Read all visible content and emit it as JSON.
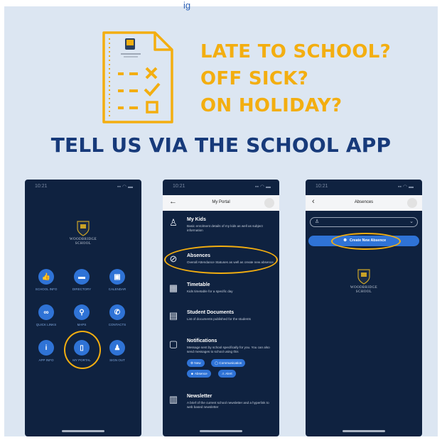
{
  "top_text": "ig",
  "headline": {
    "line1": "LATE TO SCHOOL?",
    "line2": "OFF SICK?",
    "line3": "ON HOLIDAY?"
  },
  "banner": "TELL US VIA THE SCHOOL APP",
  "colors": {
    "background": "#dce6f2",
    "accent": "#f3ae10",
    "navy": "#173a7a",
    "phone_bg": "#0f2240",
    "button_blue": "#2f73d6"
  },
  "phone1": {
    "time": "10:21",
    "school_name": "WOODBRIDGE SCHOOL",
    "buttons": [
      {
        "label": "SCHOOL INFO",
        "icon": "thumbs-up-icon",
        "glyph": "👍"
      },
      {
        "label": "DIRECTORY",
        "icon": "folder-icon",
        "glyph": "▬"
      },
      {
        "label": "CALENDAR",
        "icon": "calendar-icon",
        "glyph": "▣"
      },
      {
        "label": "QUICK LINKS",
        "icon": "link-icon",
        "glyph": "∞"
      },
      {
        "label": "MAPS",
        "icon": "map-pin-icon",
        "glyph": "⚲"
      },
      {
        "label": "CONTACTS",
        "icon": "phone-icon",
        "glyph": "✆"
      },
      {
        "label": "APP INFO",
        "icon": "info-icon",
        "glyph": "i"
      },
      {
        "label": "MY PORTAL",
        "icon": "portal-door-icon",
        "glyph": "▯"
      },
      {
        "label": "SIGN OUT",
        "icon": "users-icon",
        "glyph": "♟"
      }
    ]
  },
  "phone2": {
    "time": "10:21",
    "title": "My Portal",
    "items": [
      {
        "title": "My Kids",
        "desc": "Basic enrolment details of my kids as well as subject information",
        "icon": "student-icon",
        "glyph": "♙"
      },
      {
        "title": "Absences",
        "desc": "Overall Attendance Statuses as well as create new absence",
        "icon": "no-entry-icon",
        "glyph": "⊘"
      },
      {
        "title": "Timetable",
        "desc": "Kids timetable for a specific day",
        "icon": "timetable-icon",
        "glyph": "▦"
      },
      {
        "title": "Student Documents",
        "desc": "List of documents published for the students",
        "icon": "document-icon",
        "glyph": "▤"
      },
      {
        "title": "Notifications",
        "desc": "Message sent by school specifically for you. You can also send messages to school using this",
        "icon": "notification-icon",
        "glyph": "▢"
      },
      {
        "title": "Newsletter",
        "desc": "A brief of the current school newsletter and a hyperlink to web based newsletter",
        "icon": "newsletter-icon",
        "glyph": "▥"
      }
    ],
    "pills": [
      "New",
      "Communication",
      "Absence",
      "Alert"
    ]
  },
  "phone3": {
    "time": "10:21",
    "title": "Absences",
    "create_button": "Create New Absence",
    "school_name": "WOODBRIDGE SCHOOL"
  }
}
